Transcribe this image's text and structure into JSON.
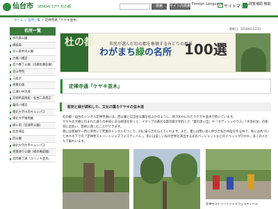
{
  "header": {
    "logo_text": "仙台市",
    "logo_sub": "SENDAI CITY 杜の都",
    "search_button": "検索",
    "site_button": "サイト内検索",
    "language": "Foreign Language",
    "sitemap": "サイトマップ",
    "reader": "閲覧補助 機能"
  },
  "breadcrumb": {
    "home": "ホーム",
    "level1": "名所一覧",
    "current": "定禅寺通「ケヤキ並木」"
  },
  "sidebar": {
    "heading": "名所一覧",
    "items": [
      "水の森公園",
      "楊枝森",
      "貝ヶ森中央公園",
      "大梶八幡宮",
      "北六番丁公園（内藤佐藤庭園）",
      "北山寺院",
      "三居沢",
      "青葉の森",
      "広瀬川中流域",
      "宮城県美術館・仙台二高周辺",
      "亀岡八幡宮",
      "東北大学川内キャンパス",
      "東北大学植物園",
      "緑ヶ岡（宮城県公園）",
      "仙台城址",
      "西公園",
      "東北大学片平キャンパス",
      "青葉通り公園（緑水庵庭園）",
      "北四番丁通「ユリノキ並木」"
    ]
  },
  "main": {
    "updated": "更新日：2018年5月23日",
    "banner_sub": "市民が選んだ杜の都を象徴するみどりの風景",
    "banner_stamp": "杜の都",
    "banner_title_a": "わがまち",
    "banner_title_b": "緑",
    "banner_title_c": "の名所",
    "banner_num": "100選",
    "page_title": "定禅寺通「ケヤキ並木」",
    "section_title": "彫刻と緑が調和した、文化の薫るケヤキの並木道",
    "body": [
      "杜の都・仙台のシンボル定禅寺通には、西公園と勾当台公園を結ぶかのように、約700mにわたりケヤキ並木が続いています。",
      "ケヤキの大樹に包まれた通りの中央にある緑道を歩くと、イタリアの著名な彫刻家が制作した「夏の思い出」や「オディュッセウス」「水浴の女」の彫刻に出会い、芸術に親しむことができます。",
      "春には新緑が一斉に芽吹いて若葉のトンネルをつくり、同に安らぎを与えてくれます。また、夏には勢い良く伸びた枝が木陰を作る中で、秋には色づいた木々の下での「定禅寺ストリートジャズフェスティバル」、冬には美しい光の世界を演出する光のページェントなどのイベントが行われ、多くの人たちで賑わいます。"
    ],
    "caption": "定禅寺ストリートジャズフェスティバル"
  },
  "colors": {
    "brand_green": "#2e8b3e",
    "title_blue": "#1f4d8a",
    "link_blue": "#2e6fb5"
  }
}
